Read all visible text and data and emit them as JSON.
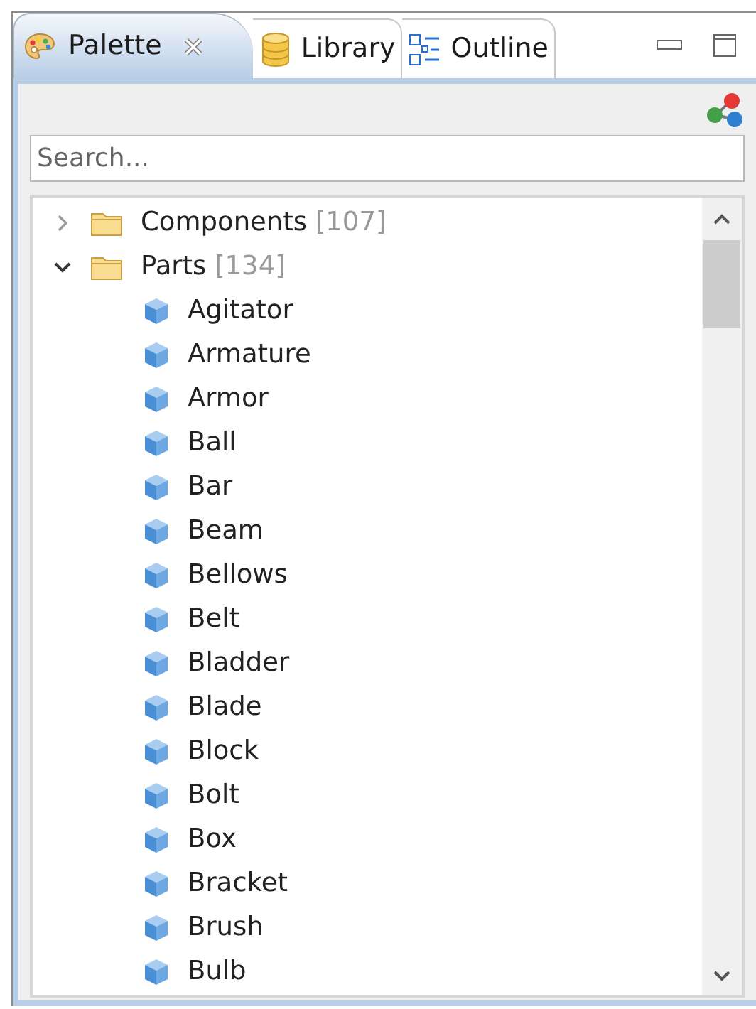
{
  "tabs": [
    {
      "label": "Palette",
      "kind": "palette",
      "selected": true,
      "closable": true
    },
    {
      "label": "Library",
      "kind": "library",
      "selected": false,
      "closable": false
    },
    {
      "label": "Outline",
      "kind": "outline",
      "selected": false,
      "closable": false
    }
  ],
  "search": {
    "placeholder": "Search..."
  },
  "tree": [
    {
      "label": "Components",
      "count": "[107]",
      "expanded": false
    },
    {
      "label": "Parts",
      "count": "[134]",
      "expanded": true,
      "children": [
        {
          "label": "Agitator"
        },
        {
          "label": "Armature"
        },
        {
          "label": "Armor"
        },
        {
          "label": "Ball"
        },
        {
          "label": "Bar"
        },
        {
          "label": "Beam"
        },
        {
          "label": "Bellows"
        },
        {
          "label": "Belt"
        },
        {
          "label": "Bladder"
        },
        {
          "label": "Blade"
        },
        {
          "label": "Block"
        },
        {
          "label": "Bolt"
        },
        {
          "label": "Box"
        },
        {
          "label": "Bracket"
        },
        {
          "label": "Brush"
        },
        {
          "label": "Bulb"
        }
      ]
    }
  ]
}
